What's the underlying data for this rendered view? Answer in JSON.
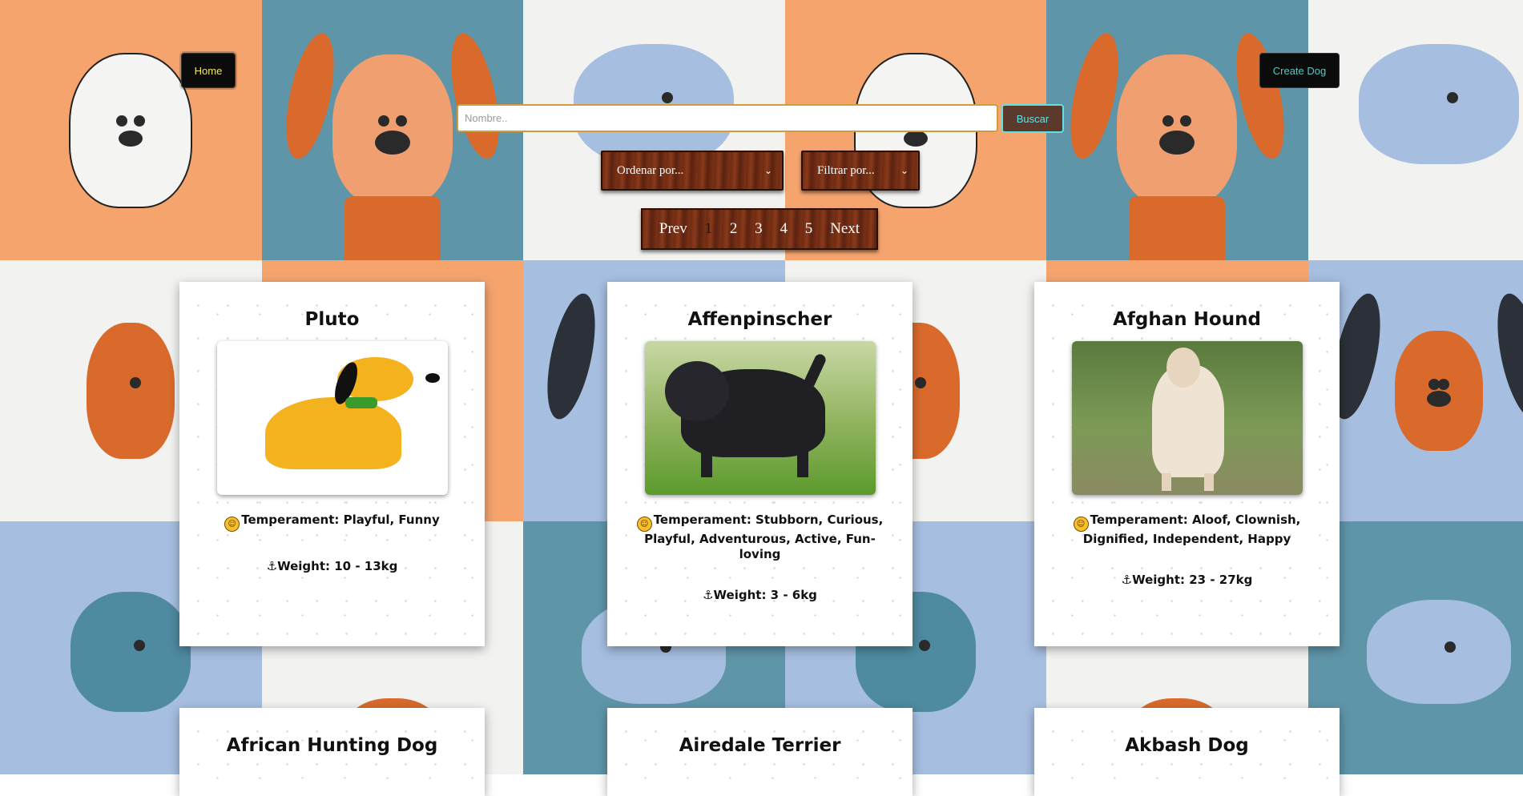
{
  "nav": {
    "home_label": "Home",
    "create_label": "Create Dog"
  },
  "search": {
    "placeholder": "Nombre..",
    "button_label": "Buscar"
  },
  "selects": {
    "order_label": "Ordenar por...",
    "filter_label": "Filtrar por..."
  },
  "pagination": {
    "prev": "Prev",
    "next": "Next",
    "pages": [
      "1",
      "2",
      "3",
      "4",
      "5"
    ],
    "active_page": "1"
  },
  "cards": [
    {
      "name": "Pluto",
      "temperament": "Temperament: Playful, Funny",
      "weight": "Weight: 10 - 13kg"
    },
    {
      "name": "Affenpinscher",
      "temperament": "Temperament: Stubborn, Curious, Playful, Adventurous, Active, Fun-loving",
      "weight": "Weight: 3 - 6kg"
    },
    {
      "name": "Afghan Hound",
      "temperament": "Temperament: Aloof, Clownish, Dignified, Independent, Happy",
      "weight": "Weight: 23 - 27kg"
    },
    {
      "name": "African Hunting Dog"
    },
    {
      "name": "Airedale Terrier"
    },
    {
      "name": "Akbash Dog"
    }
  ],
  "icons": {
    "temperament": "smiley-icon",
    "weight": "weight-icon"
  },
  "colors": {
    "orange": "#f5a46e",
    "teal": "#5f95a8",
    "white": "#f2f2f0",
    "blue": "#a6bee0",
    "home_text": "#f1e76a",
    "create_text": "#58c6c0"
  }
}
